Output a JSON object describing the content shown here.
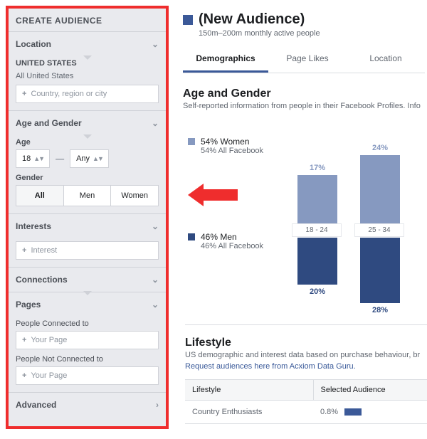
{
  "sidebar": {
    "title": "CREATE AUDIENCE",
    "location": {
      "head": "Location",
      "region_head": "UNITED STATES",
      "region_sub": "All United States",
      "placeholder": "Country, region or city"
    },
    "age_gender": {
      "head": "Age and Gender",
      "age_label": "Age",
      "age_from": "18",
      "age_to": "Any",
      "gender_label": "Gender",
      "gender_opts": [
        "All",
        "Men",
        "Women"
      ]
    },
    "interests": {
      "head": "Interests",
      "placeholder": "Interest"
    },
    "connections": {
      "head": "Connections"
    },
    "pages": {
      "head": "Pages",
      "connected_label": "People Connected to",
      "connected_ph": "Your Page",
      "not_connected_label": "People Not Connected to",
      "not_connected_ph": "Your Page"
    },
    "advanced": {
      "head": "Advanced"
    }
  },
  "header": {
    "title": "(New Audience)",
    "subtitle": "150m–200m monthly active people"
  },
  "tabs": [
    "Demographics",
    "Page Likes",
    "Location"
  ],
  "age_gender_section": {
    "heading": "Age and Gender",
    "desc": "Self-reported information from people in their Facebook Profiles. Info",
    "women": {
      "pct": "54% Women",
      "sub": "54% All Facebook"
    },
    "men": {
      "pct": "46% Men",
      "sub": "46% All Facebook"
    }
  },
  "chart_data": {
    "type": "bar",
    "categories": [
      "18 - 24",
      "25 - 34"
    ],
    "series": [
      {
        "name": "Women",
        "values": [
          17,
          24
        ],
        "color": "#8699c0"
      },
      {
        "name": "Men",
        "values": [
          20,
          28
        ],
        "color": "#2f4a80"
      }
    ],
    "labels": {
      "women": [
        "17%",
        "24%"
      ],
      "men": [
        "20%",
        "28%"
      ]
    },
    "orientation": "vertical-mirrored"
  },
  "lifestyle": {
    "heading": "Lifestyle",
    "desc": "US demographic and interest data based on purchase behaviour, br",
    "link": "Request audiences here from Acxiom Data Guru.",
    "cols": [
      "Lifestyle",
      "Selected Audience"
    ],
    "row1": {
      "name": "Country Enthusiasts",
      "pct": "0.8%"
    }
  }
}
